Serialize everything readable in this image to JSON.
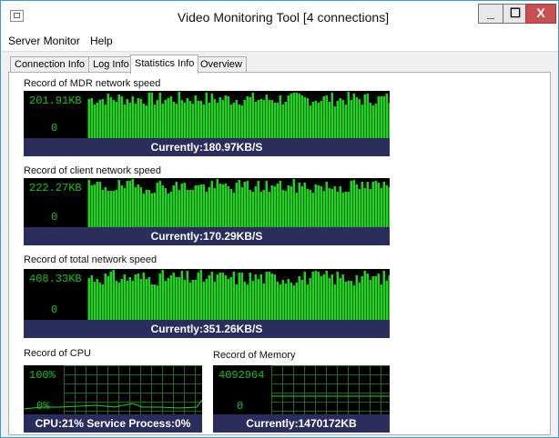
{
  "window": {
    "title": "Video Monitoring Tool [4 connections]",
    "buttons": {
      "minimize": "_",
      "maximize": "☐",
      "close": "X"
    }
  },
  "menu": [
    "Server Monitor",
    "Help"
  ],
  "tabs": [
    "Connection Info",
    "Log Info",
    "Statistics Info",
    "Overview"
  ],
  "active_tab": "Statistics Info",
  "graphs": {
    "mdr": {
      "label": "Record of MDR network speed",
      "max": "201.91KB",
      "min": "0",
      "status": "Currently:180.97KB/S"
    },
    "client": {
      "label": "Record of client network speed",
      "max": "222.27KB",
      "min": "0",
      "status": "Currently:170.29KB/S"
    },
    "total": {
      "label": "Record of total network speed",
      "max": "408.33KB",
      "min": "0",
      "status": "Currently:351.26KB/S"
    },
    "cpu": {
      "label": "Record of  CPU",
      "max": "100%",
      "min": "0%",
      "status": "CPU:21% Service Process:0%"
    },
    "memory": {
      "label": "Record of Memory",
      "max": "4092964",
      "min": "0",
      "status": "Currently:1470172KB"
    }
  },
  "colors": {
    "graph_bg": "#000000",
    "bar_fill": "#1fd41f",
    "status_bg": "#2b2d5c",
    "accent": "#3a9ad9",
    "close_btn": "#c75050"
  }
}
